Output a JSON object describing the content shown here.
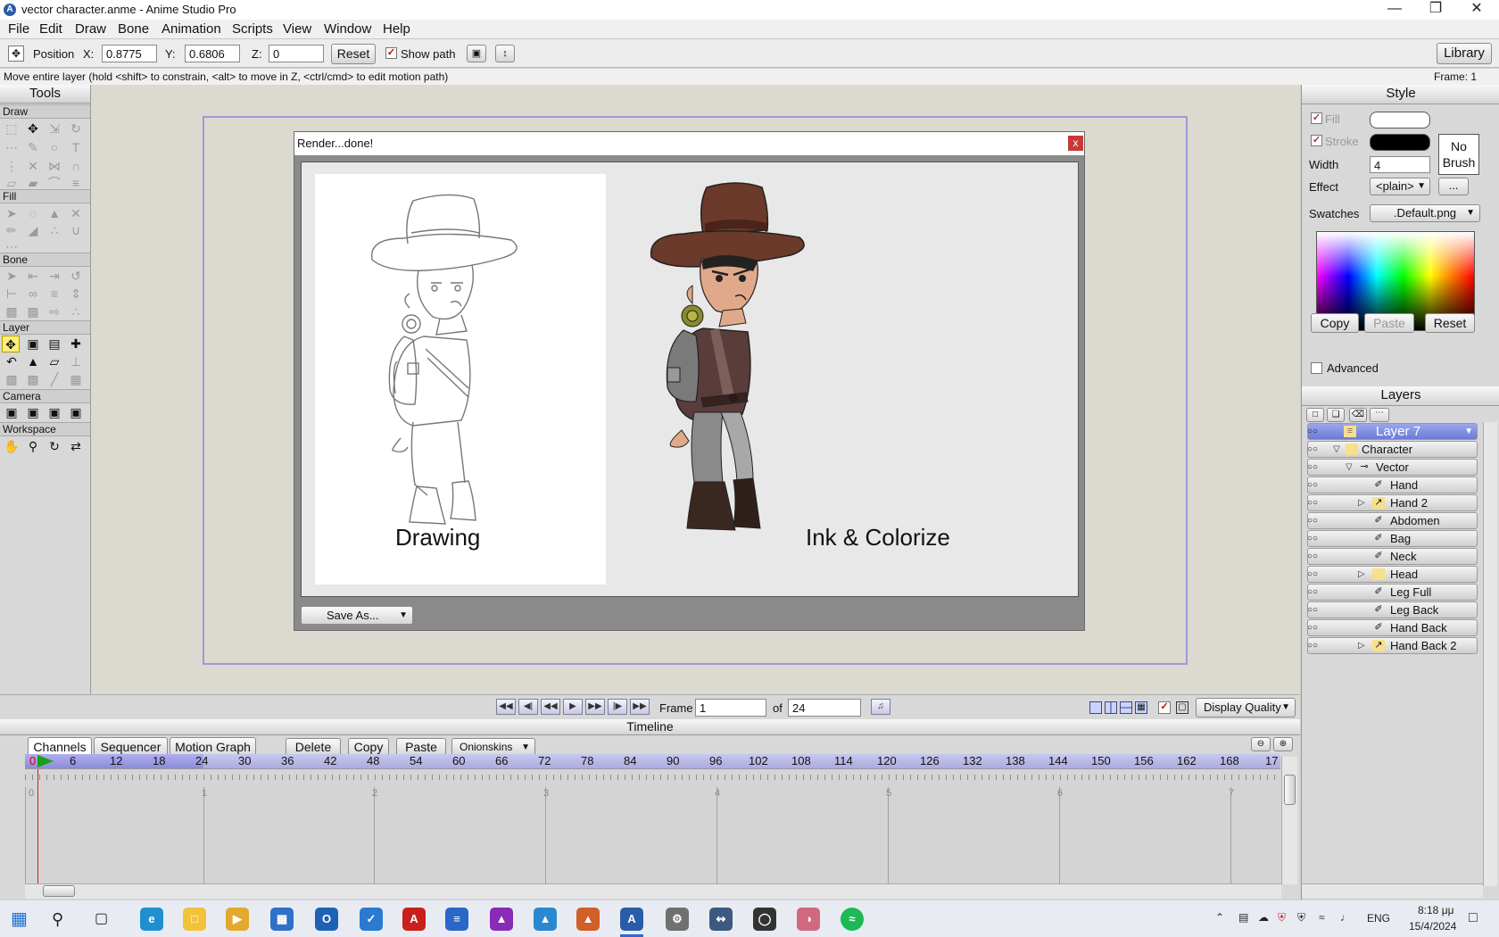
{
  "window": {
    "title": "vector character.anme - Anime Studio Pro",
    "controls": [
      "minimize",
      "restore",
      "close"
    ]
  },
  "menu": [
    "File",
    "Edit",
    "Draw",
    "Bone",
    "Animation",
    "Scripts",
    "View",
    "Window",
    "Help"
  ],
  "options_bar": {
    "tool_label": "Position",
    "x_label": "X:",
    "x_value": "0.8775",
    "y_label": "Y:",
    "y_value": "0.6806",
    "z_label": "Z:",
    "z_value": "0",
    "reset_label": "Reset",
    "show_path_label": "Show path",
    "show_path_checked": true,
    "library_label": "Library"
  },
  "status": {
    "hint": "Move entire layer (hold <shift> to constrain, <alt> to move in Z, <ctrl/cmd> to edit motion path)",
    "frame": "Frame: 1"
  },
  "tools": {
    "title": "Tools",
    "sections": [
      "Draw",
      "Fill",
      "Bone",
      "Layer",
      "Camera",
      "Workspace"
    ]
  },
  "dialog": {
    "title": "Render...done!",
    "close_label": "x",
    "left_caption": "Drawing",
    "right_caption": "Ink & Colorize",
    "save_as_label": "Save As..."
  },
  "style_panel": {
    "title": "Style",
    "fill_label": "Fill",
    "stroke_label": "Stroke",
    "width_label": "Width",
    "width_value": "4",
    "no_brush_label": "No Brush",
    "effect_label": "Effect",
    "effect_value": "<plain>",
    "more_label": "...",
    "swatches_label": "Swatches",
    "swatches_value": ".Default.png",
    "copy_label": "Copy",
    "paste_label": "Paste",
    "reset_label": "Reset",
    "advanced_label": "Advanced",
    "fill_color": "#ffffff",
    "stroke_color": "#000000"
  },
  "layers_panel": {
    "title": "Layers",
    "items": [
      {
        "name": "Layer 7",
        "type": "note",
        "selected": true
      },
      {
        "name": "Character",
        "type": "group"
      },
      {
        "name": "Vector",
        "type": "bone"
      },
      {
        "name": "Hand",
        "type": "vector"
      },
      {
        "name": "Hand 2",
        "type": "switch"
      },
      {
        "name": "Abdomen",
        "type": "vector"
      },
      {
        "name": "Bag",
        "type": "vector"
      },
      {
        "name": "Neck",
        "type": "vector"
      },
      {
        "name": "Head",
        "type": "group"
      },
      {
        "name": "Leg Full",
        "type": "vector"
      },
      {
        "name": "Leg Back",
        "type": "vector"
      },
      {
        "name": "Hand Back",
        "type": "vector"
      },
      {
        "name": "Hand Back 2",
        "type": "switch"
      }
    ]
  },
  "playback": {
    "frame_label": "Frame",
    "frame_value": "1",
    "of_label": "of",
    "total_value": "24",
    "display_quality_label": "Display Quality"
  },
  "timeline": {
    "title": "Timeline",
    "tabs": [
      "Channels",
      "Sequencer",
      "Motion Graph"
    ],
    "buttons": [
      "Delete",
      "Copy",
      "Paste",
      "Onionskins"
    ],
    "ruler_ticks": [
      "0",
      "6",
      "12",
      "18",
      "24",
      "30",
      "36",
      "42",
      "48",
      "54",
      "60",
      "66",
      "72",
      "78",
      "84",
      "90",
      "96",
      "102",
      "108",
      "114",
      "120",
      "126",
      "132",
      "138",
      "144",
      "150",
      "156",
      "162",
      "168",
      "17"
    ],
    "seconds": [
      "0",
      "1",
      "2",
      "3",
      "4",
      "5",
      "6",
      "7"
    ]
  },
  "taskbar": {
    "language": "ENG",
    "time": "8:18 μμ",
    "date": "15/4/2024"
  }
}
